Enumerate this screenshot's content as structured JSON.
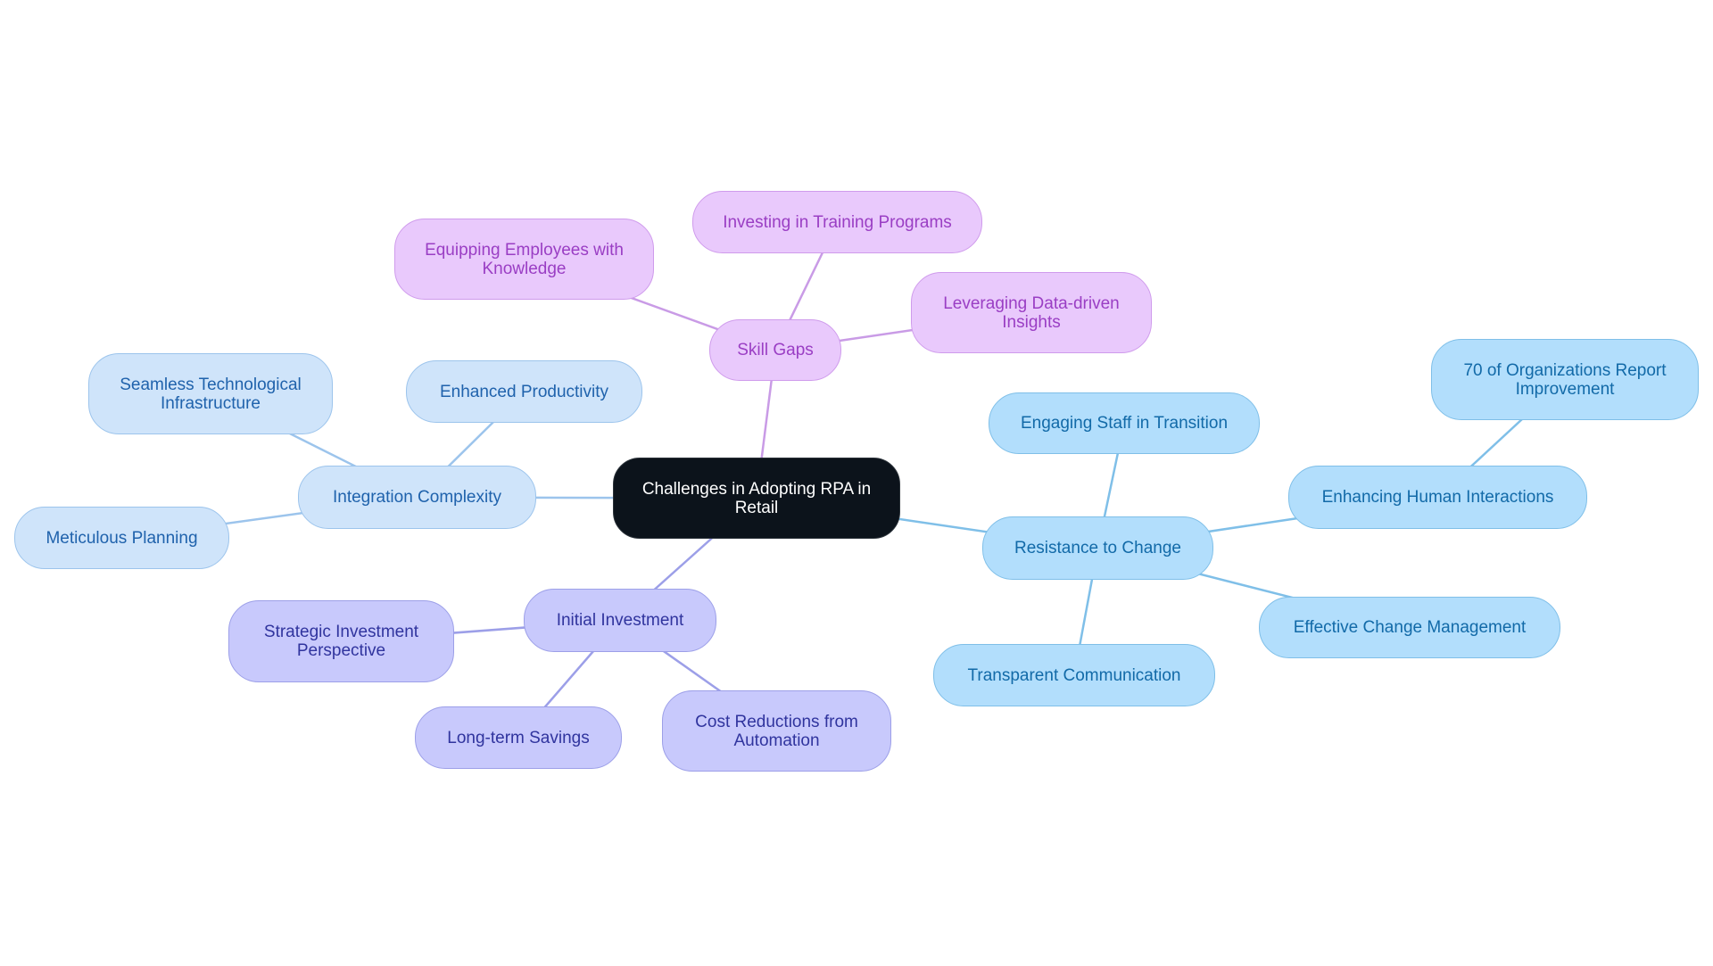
{
  "diagram": {
    "type": "mindmap",
    "root": {
      "id": "root",
      "label": "Challenges in Adopting RPA in Retail"
    },
    "branches": [
      {
        "id": "skill-gaps",
        "label": "Skill Gaps",
        "color_theme": "purple",
        "children": [
          {
            "id": "investing-training",
            "label": "Investing in Training Programs"
          },
          {
            "id": "equipping-employees",
            "label": "Equipping Employees with Knowledge"
          },
          {
            "id": "leveraging-data",
            "label": "Leveraging Data-driven Insights"
          }
        ]
      },
      {
        "id": "integration-complexity",
        "label": "Integration Complexity",
        "color_theme": "lightblue",
        "children": [
          {
            "id": "seamless-infrastructure",
            "label": "Seamless Technological Infrastructure"
          },
          {
            "id": "enhanced-productivity",
            "label": "Enhanced Productivity"
          },
          {
            "id": "meticulous-planning",
            "label": "Meticulous Planning"
          }
        ]
      },
      {
        "id": "initial-investment",
        "label": "Initial Investment",
        "color_theme": "indigo",
        "children": [
          {
            "id": "strategic-investment",
            "label": "Strategic Investment Perspective"
          },
          {
            "id": "long-term-savings",
            "label": "Long-term Savings"
          },
          {
            "id": "cost-reductions",
            "label": "Cost Reductions from Automation"
          }
        ]
      },
      {
        "id": "resistance-to-change",
        "label": "Resistance to Change",
        "color_theme": "skyblue",
        "children": [
          {
            "id": "engaging-staff",
            "label": "Engaging Staff in Transition"
          },
          {
            "id": "enhancing-human",
            "label": "Enhancing Human Interactions",
            "children": [
              {
                "id": "seventy-orgs",
                "label": "70 of Organizations Report Improvement"
              }
            ]
          },
          {
            "id": "effective-change",
            "label": "Effective Change Management"
          },
          {
            "id": "transparent-communication",
            "label": "Transparent Communication"
          }
        ]
      }
    ],
    "colors": {
      "root_fill": "#0c131b",
      "purple_fill": "#e9c9fc",
      "purple_text": "#9a3ec4",
      "purple_edge": "#c99be6",
      "lightblue_fill": "#cfe4fa",
      "lightblue_text": "#1f62ac",
      "lightblue_edge": "#9cc4ec",
      "indigo_fill": "#c8c9fc",
      "indigo_text": "#30349e",
      "indigo_edge": "#9c9fe8",
      "skyblue_fill": "#b2defc",
      "skyblue_text": "#126aa8",
      "skyblue_edge": "#7fbfe8"
    }
  }
}
